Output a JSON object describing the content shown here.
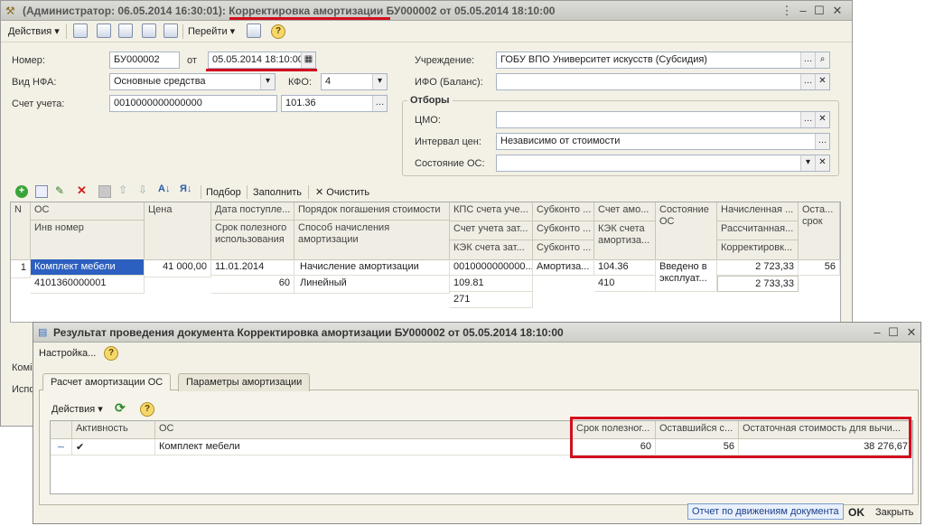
{
  "main_window": {
    "title_prefix": "(Администратор: 06.05.2014 16:30:01): ",
    "title_doc": "Корректировка амортизации",
    "title_suffix": " БУ000002 от 05.05.2014 18:10:00",
    "toolbar": {
      "actions": "Действия",
      "goto": "Перейти"
    },
    "form": {
      "number_label": "Номер:",
      "number_value": "БУ000002",
      "from_label": "от",
      "date_value": "05.05.2014 18:10:00",
      "nfa_label": "Вид НФА:",
      "nfa_value": "Основные средства",
      "kfo_label": "КФО:",
      "kfo_value": "4",
      "account_label": "Счет учета:",
      "account_value": "0010000000000000",
      "account_sub": "101.36",
      "institution_label": "Учреждение:",
      "institution_value": "ГОБУ ВПО Университет искусств (Субсидия)",
      "ifo_label": "ИФО (Баланс):",
      "ifo_value": "",
      "filters_label": "Отборы",
      "cmo_label": "ЦМО:",
      "cmo_value": "",
      "price_label": "Интервал цен:",
      "price_value": "Независимо от стоимости",
      "state_label": "Состояние ОС:",
      "state_value": ""
    },
    "grid_toolbar": {
      "pick": "Подбор",
      "fill": "Заполнить",
      "clear": "Очистить"
    },
    "grid": {
      "headers": {
        "n": "N",
        "os": "ОС",
        "inv": "Инв номер",
        "price": "Цена",
        "date": "Дата поступле...",
        "life": "Срок полезного использования",
        "order": "Порядок погашения стоимости",
        "method": "Способ начисления амортизации",
        "kps": "КПС счета уче...",
        "acc_cost": "Счет учета зат...",
        "kek_cost": "КЭК счета зат...",
        "sub1": "Субконто ...",
        "sub2": "Субконто ...",
        "sub3": "Субконто ...",
        "acc_am": "Счет амо...",
        "kek_am": "КЭК счета амортиза...",
        "state": "Состояние ОС",
        "charged": "Начисленная ...",
        "calc": "Рассчитанная...",
        "corr": "Корректировк...",
        "rest": "Оста... срок"
      },
      "row": {
        "n": "1",
        "os": "Комплект мебели",
        "inv": "4101360000001",
        "price": "41 000,00",
        "date": "11.01.2014",
        "life": "60",
        "order": "Начисление амортизации",
        "method": "Линейный",
        "kps": "0010000000000...",
        "acc_cost": "109.81",
        "kek_cost": "271",
        "sub1": "Амортиза...",
        "acc_am": "104.36",
        "kek_am": "410",
        "state": "Введено в эксплуат...",
        "charged": "2 723,33",
        "calc": "2 733,33",
        "rest": "56"
      }
    },
    "side_labels": [
      "Комі",
      "Испо"
    ]
  },
  "result_window": {
    "title": "Результат проведения документа Корректировка амортизации БУ000002 от 05.05.2014 18:10:00",
    "settings": "Настройка...",
    "tabs": [
      "Расчет амортизации ОС",
      "Параметры амортизации"
    ],
    "actions": "Действия",
    "grid": {
      "headers": {
        "active": "Активность",
        "os": "ОС",
        "life": "Срок полезног...",
        "remain": "Оставшийся с...",
        "residual": "Остаточная стоимость для вычи..."
      },
      "row": {
        "active": "✔",
        "os": "Комплект мебели",
        "life": "60",
        "remain": "56",
        "residual": "38 276,67"
      }
    },
    "footer": {
      "report": "Отчет по движениям документа",
      "ok": "OK",
      "close": "Закрыть"
    }
  },
  "colors": {
    "highlight": "#d10f1f",
    "selected_row": "#2c5fbf"
  }
}
